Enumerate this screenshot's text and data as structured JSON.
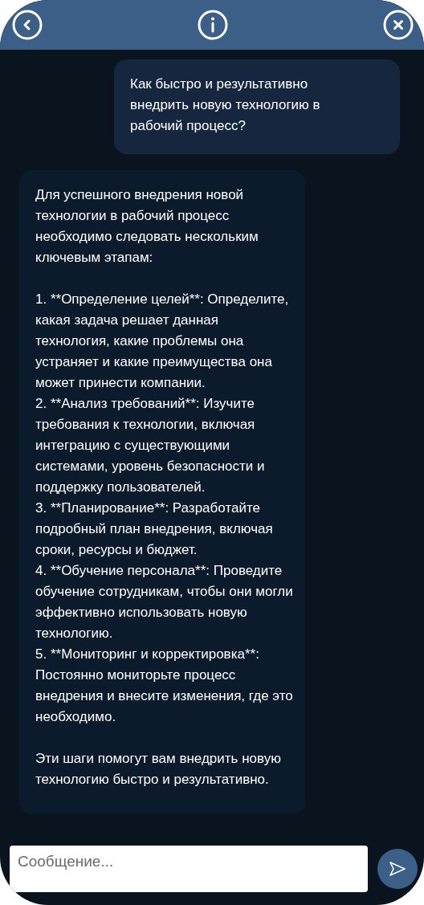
{
  "header": {
    "buttons": [
      {
        "kind": "back"
      },
      {
        "kind": "info"
      },
      {
        "kind": "close"
      }
    ]
  },
  "messages": [
    {
      "kind": "user",
      "paragraphs": [
        {
          "kind": "intro",
          "text": "Как быстро и результативно внедрить новую технологию в рабочий процесс?"
        }
      ]
    },
    {
      "kind": "bot",
      "paragraphs": [
        {
          "kind": "intro",
          "text": "Для успешного внедрения новой технологии в рабочий процесс необходимо следовать нескольким ключевым этапам:"
        },
        {
          "kind": "step",
          "text": "1. **Определение целей**: Определите, какая задача решает данная технология, какие проблемы она устраняет и какие преимущества она может принести компании."
        },
        {
          "kind": "step",
          "text": "2. **Анализ требований**: Изучите требования к технологии, включая интеграцию с существующими системами, уровень безопасности и поддержку пользователей."
        },
        {
          "kind": "step",
          "text": "3. **Планирование**: Разработайте подробный план внедрения, включая сроки, ресурсы и бюджет."
        },
        {
          "kind": "step",
          "text": "4. **Обучение персонала**: Проведите обучение сотрудникам, чтобы они могли эффективно использовать новую технологию."
        },
        {
          "kind": "step",
          "text": "5. **Мониторинг и корректировка**: Постоянно мониторьте процесс внедрения и внесите изменения, где это необходимо."
        },
        {
          "kind": "outro",
          "text": "Эти шаги помогут вам внедрить новую технологию быстро и результативно."
        }
      ]
    }
  ],
  "composer": {
    "placeholder": "Сообщение..."
  }
}
